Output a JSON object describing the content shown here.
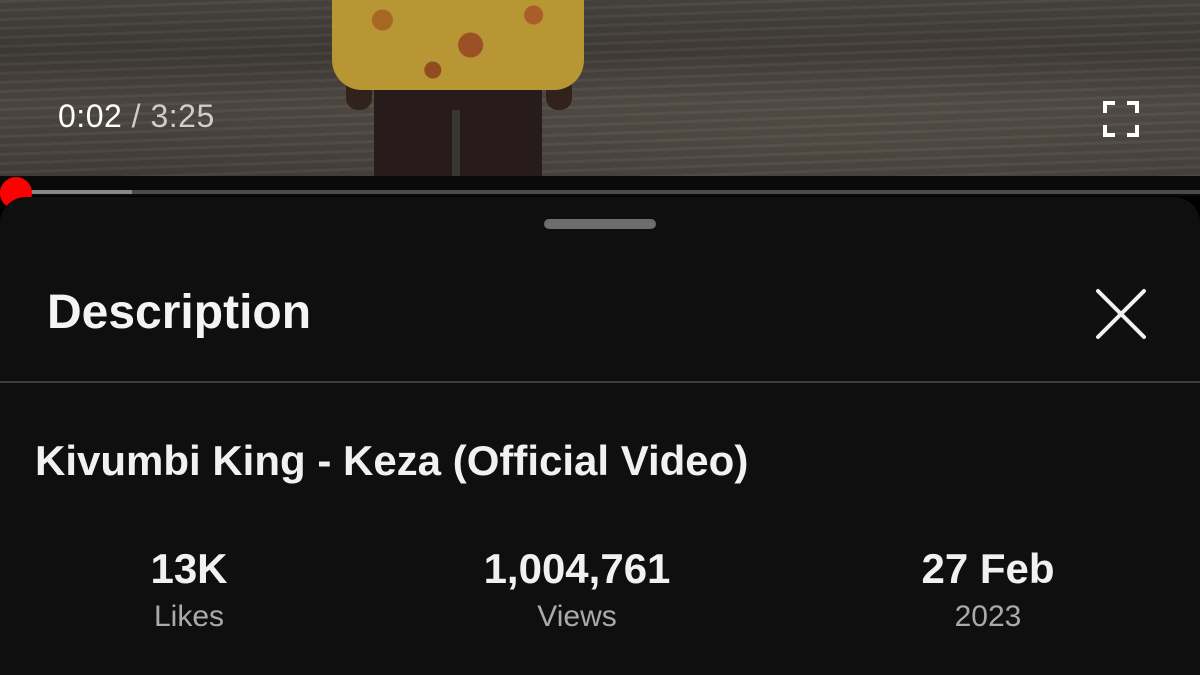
{
  "player": {
    "current_time": "0:02",
    "separator": "/",
    "duration": "3:25",
    "progress_fraction": 0.0098,
    "buffered_fraction": 0.11,
    "fullscreen_icon": "fullscreen-icon"
  },
  "sheet": {
    "title": "Description",
    "close_icon": "close-icon"
  },
  "video": {
    "title": "Kivumbi King - Keza (Official Video)",
    "stats": [
      {
        "value": "13K",
        "label": "Likes"
      },
      {
        "value": "1,004,761",
        "label": "Views"
      },
      {
        "value": "27 Feb",
        "label": "2023"
      }
    ]
  },
  "colors": {
    "accent": "#ff0000",
    "sheet_bg": "#0f0f0f",
    "text_primary": "#f1f1f1",
    "text_secondary": "#aaaaaa"
  }
}
